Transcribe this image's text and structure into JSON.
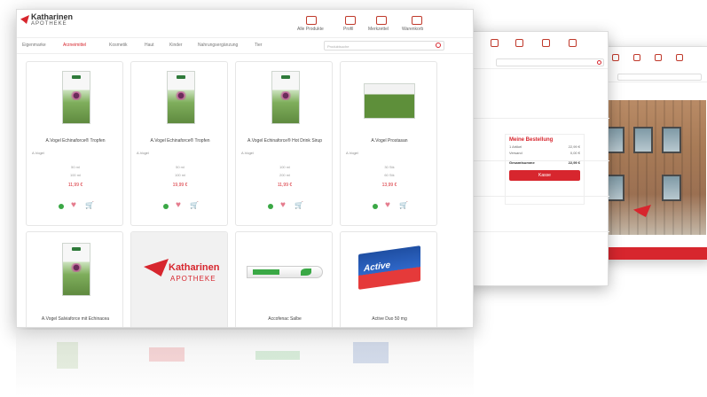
{
  "brand": {
    "name": "Katharinen",
    "sub": "APOTHEKE"
  },
  "header_nav": [
    {
      "label": "Alle Produkte",
      "icon": "grid-icon"
    },
    {
      "label": "Profil",
      "icon": "user-icon"
    },
    {
      "label": "Merkzettel",
      "icon": "heart-icon"
    },
    {
      "label": "Warenkorb",
      "icon": "cart-icon"
    }
  ],
  "categories": [
    "Eigenmarke",
    "Arzneimittel",
    "Kosmetik",
    "Haut",
    "Kinder",
    "Nahrungsergänzung",
    "Tier"
  ],
  "search": {
    "placeholder": "Produktsuche"
  },
  "products": [
    {
      "name": "A.Vogel Echinaforce® Tropfen",
      "meta": "A.Vogel",
      "p1": "50 ml",
      "p2": "100 ml",
      "price": "11,99 €"
    },
    {
      "name": "A.Vogel Echinaforce® Tropfen",
      "meta": "A.Vogel",
      "p1": "50 ml",
      "p2": "100 ml",
      "price": "19,99 €"
    },
    {
      "name": "A.Vogel Echinaforce® Hot Drink Sirup",
      "meta": "A.Vogel",
      "p1": "100 ml",
      "p2": "200 ml",
      "price": "11,99 €"
    },
    {
      "name": "A.Vogel Prostasan",
      "meta": "A.Vogel",
      "p1": "30 Stk",
      "p2": "60 Stk",
      "price": "13,99 €"
    }
  ],
  "products_row2": [
    {
      "name": "A.Vogel Salviaforce mit Echinacea"
    },
    {
      "name": ""
    },
    {
      "name": "Accofenac Salbe"
    },
    {
      "name": "Active Duo 50 mg"
    }
  ],
  "cart": {
    "title": "Meine Bestellung",
    "lines": [
      {
        "label": "1 Artikel",
        "value": "22,99 €"
      },
      {
        "label": "Versand",
        "value": "0,00 €"
      }
    ],
    "total_label": "Gesamtsumme",
    "total_value": "22,99 €",
    "checkout": "Kasse"
  },
  "colors": {
    "accent": "#d7262e",
    "available": "#3aa845"
  }
}
